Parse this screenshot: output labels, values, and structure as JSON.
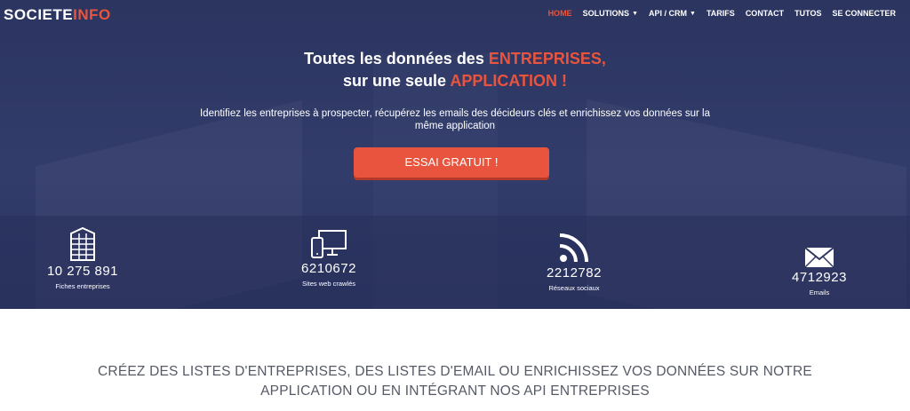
{
  "logo": {
    "part1": "SOCIETE",
    "part2": "INFO"
  },
  "nav": [
    {
      "label": "HOME",
      "active": true,
      "dropdown": false
    },
    {
      "label": "SOLUTIONS",
      "active": false,
      "dropdown": true
    },
    {
      "label": "API / CRM",
      "active": false,
      "dropdown": true
    },
    {
      "label": "TARIFS",
      "active": false,
      "dropdown": false
    },
    {
      "label": "CONTACT",
      "active": false,
      "dropdown": false
    },
    {
      "label": "TUTOS",
      "active": false,
      "dropdown": false
    },
    {
      "label": "SE CONNECTER",
      "active": false,
      "dropdown": false
    }
  ],
  "hero": {
    "line1_pre": "Toutes les données des ",
    "line1_accent": "ENTREPRISES,",
    "line2_pre": "sur une seule ",
    "line2_accent": "APPLICATION !",
    "subtitle": "Identifiez les entreprises à prospecter, récupérez les emails des décideurs clés et enrichissez vos données sur la même application",
    "cta": "ESSAI GRATUIT !"
  },
  "stats": [
    {
      "icon": "building-icon",
      "value": "10 275 891",
      "label": "Fiches entreprises"
    },
    {
      "icon": "devices-icon",
      "value": "6210672",
      "label": "Sites web crawlés"
    },
    {
      "icon": "rss-icon",
      "value": "2212782",
      "label": "Réseaux sociaux"
    },
    {
      "icon": "envelope-icon",
      "value": "4712923",
      "label": "Emails"
    }
  ],
  "bottom_text": "CRÉEZ DES LISTES D'ENTREPRISES, DES LISTES D'EMAIL OU ENRICHISSEZ VOS DONNÉES SUR NOTRE APPLICATION OU EN INTÉGRANT NOS API ENTREPRISES",
  "colors": {
    "accent": "#e8543d",
    "hero_bg": "#2f3864",
    "text_dark": "#555a66"
  }
}
